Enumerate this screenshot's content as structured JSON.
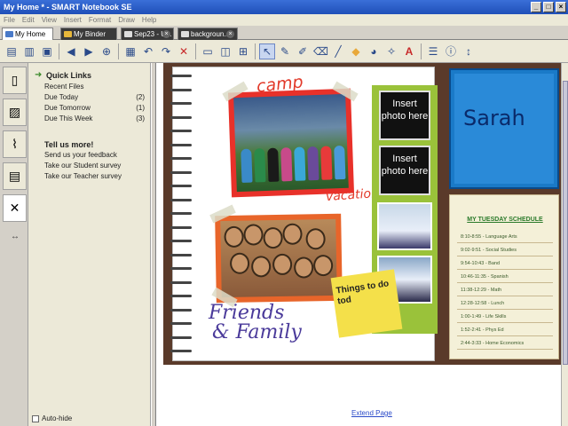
{
  "window": {
    "title": "My Home * - SMART Notebook SE"
  },
  "menu": [
    "File",
    "Edit",
    "View",
    "Insert",
    "Format",
    "Draw",
    "Help"
  ],
  "tabs": [
    {
      "label": "My Home",
      "active": true,
      "icon": "home-icon"
    },
    {
      "label": "My Binder",
      "active": false,
      "icon": "folder-icon"
    },
    {
      "label": "Sep23 - U...",
      "active": false,
      "icon": "doc-icon"
    },
    {
      "label": "backgroun...",
      "active": false,
      "icon": "doc-icon"
    }
  ],
  "toolbar": {
    "buttons": [
      "document-icon",
      "binder-icon",
      "save-icon",
      "back-icon",
      "forward-icon",
      "add-page-icon",
      "paste-icon",
      "undo-icon",
      "redo-icon",
      "delete-icon",
      "screen-shade-icon",
      "capture-icon",
      "table-icon",
      "select-icon",
      "pen-icon",
      "creative-pen-icon",
      "eraser-icon",
      "line-icon",
      "shape-icon",
      "fill-icon",
      "magic-pen-icon",
      "text-icon",
      "properties-icon",
      "info-icon",
      "more-icon"
    ]
  },
  "sidebar": {
    "tabs": [
      "page-sorter-icon",
      "gallery-icon",
      "attachments-icon",
      "properties-icon",
      "quick-links-icon"
    ],
    "quick_links_title": "Quick Links",
    "quick_links": [
      {
        "label": "Recent Files",
        "count": ""
      },
      {
        "label": "Due Today",
        "count": "(2)"
      },
      {
        "label": "Due Tomorrow",
        "count": "(1)"
      },
      {
        "label": "Due This Week",
        "count": "(3)"
      }
    ],
    "tell_us": "Tell us more!",
    "feedback_links": [
      "Send us your feedback",
      "Take our Student survey",
      "Take our Teacher survey"
    ],
    "auto_hide": "Auto-hide"
  },
  "page": {
    "camp": "camp",
    "vacation": "vacation",
    "friends_line1": "Friends",
    "friends_line2": "& Family",
    "sticky": "Things to do tod",
    "insert1": "Insert photo here",
    "insert2": "Insert photo here",
    "name": "Sarah",
    "schedule_title": "MY TUESDAY SCHEDULE",
    "schedule": [
      "8:10-8:55 - Language Arts",
      "9:02-9:51 - Social Studies",
      "9:54-10:43 - Band",
      "10:46-11:35 - Spanish",
      "11:38-12:29 - Math",
      "12:28-12:58 - Lunch",
      "1:00-1:49 - Life Skills",
      "1:52-2:41 - Phys Ed",
      "2:44-3:33 - Home Economics"
    ],
    "extend": "Extend Page"
  }
}
